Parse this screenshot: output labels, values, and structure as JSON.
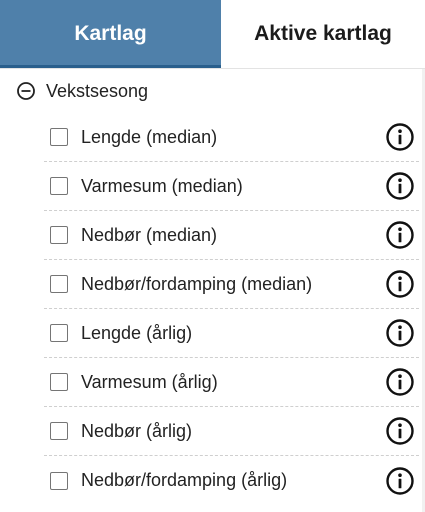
{
  "tabs": [
    {
      "label": "Kartlag",
      "active": true
    },
    {
      "label": "Aktive kartlag",
      "active": false
    }
  ],
  "group": {
    "label": "Vekstsesong",
    "icon": "minus-circle-icon",
    "expanded": true
  },
  "layers": [
    {
      "label": "Lengde (median)",
      "checked": false,
      "info_icon": "info-icon"
    },
    {
      "label": "Varmesum (median)",
      "checked": false,
      "info_icon": "info-icon"
    },
    {
      "label": "Nedbør (median)",
      "checked": false,
      "info_icon": "info-icon"
    },
    {
      "label": "Nedbør/fordamping (median)",
      "checked": false,
      "info_icon": "info-icon"
    },
    {
      "label": "Lengde (årlig)",
      "checked": false,
      "info_icon": "info-icon"
    },
    {
      "label": "Varmesum (årlig)",
      "checked": false,
      "info_icon": "info-icon"
    },
    {
      "label": "Nedbør (årlig)",
      "checked": false,
      "info_icon": "info-icon"
    },
    {
      "label": "Nedbør/fordamping (årlig)",
      "checked": false,
      "info_icon": "info-icon"
    }
  ],
  "colors": {
    "active_tab_bg": "#4f80aa",
    "active_tab_border": "#2a5f8c",
    "text": "#222222",
    "checkbox_border": "#757575"
  }
}
